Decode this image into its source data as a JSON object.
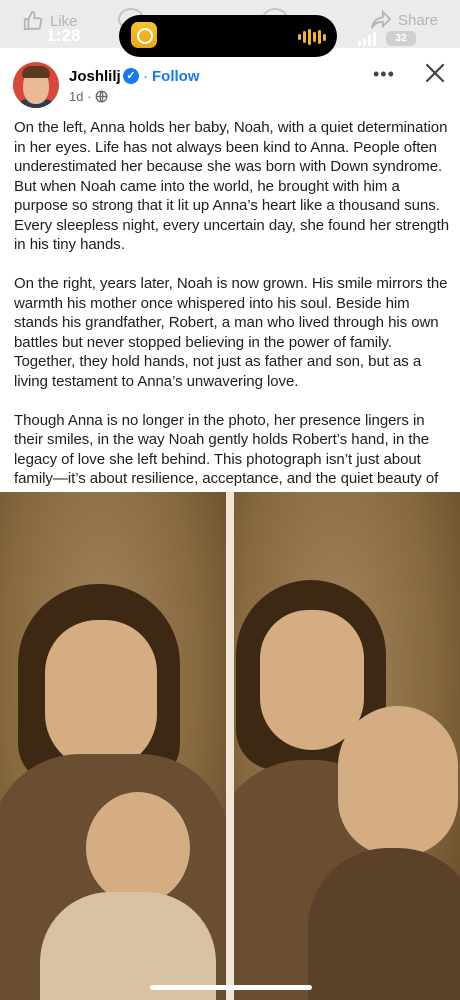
{
  "action_bar": {
    "like_label": "Like",
    "share_label": "Share"
  },
  "status_bar": {
    "time": "1:28",
    "battery": "32"
  },
  "post": {
    "author": "Joshlilj",
    "separator": "·",
    "follow_label": "Follow",
    "timestamp": "1d ·",
    "more_label": "•••",
    "caption": [
      "On the left, Anna holds her baby, Noah, with a quiet determination in her eyes. Life has not always been kind to Anna. People often underestimated her because she was born with Down syndrome. But when Noah came into the world, he brought with him a purpose so strong that it lit up Anna’s heart like a thousand suns. Every sleepless night, every uncertain day, she found her strength in his tiny hands.",
      "On the right, years later, Noah is now grown. His smile mirrors the warmth his mother once whispered into his soul. Beside him stands his grandfather, Robert, a man who lived through his own battles but never stopped believing in the power of family. Together, they hold hands, not just as father and son, but as a living testament to Anna’s unwavering love.",
      "Though Anna is no longer in the photo, her presence lingers in their smiles, in the way Noah gently holds Robert’s hand, in the legacy of love she left behind. This photograph isn’t just about family—it’s about resilience, acceptance, and the quiet beauty of love that asks for nothing but to be shared."
    ]
  },
  "icons": {
    "like": "thumbs-up-icon",
    "share": "share-arrow-icon",
    "verified": "verified-badge-icon",
    "audience": "globe-icon",
    "more": "more-horizontal-icon",
    "close": "close-icon"
  },
  "colors": {
    "link_blue": "#1877f2",
    "photo_sepia": "#86693f"
  }
}
